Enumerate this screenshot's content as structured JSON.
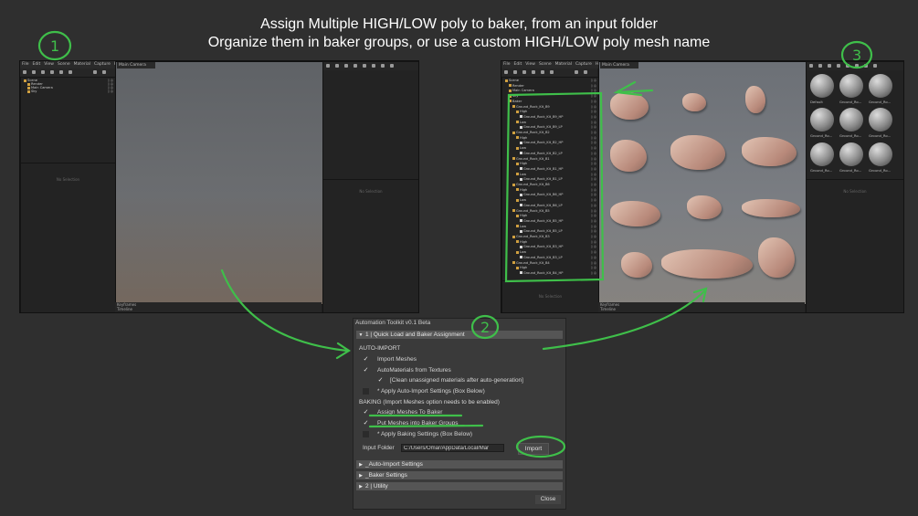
{
  "headline": {
    "line1": "Assign Multiple HIGH/LOW poly to baker, from an input folder",
    "line2": "Organize them in baker groups, or use a custom HIGH/LOW poly mesh name"
  },
  "annotations": {
    "step1": "1",
    "step2": "2",
    "step3": "3"
  },
  "app": {
    "menu": [
      "File",
      "Edit",
      "View",
      "Scene",
      "Material",
      "Capture",
      "Help"
    ],
    "viewport_tab": "Main Camera",
    "no_selection": "No Selection",
    "keyframes": "Keyframes",
    "timeline": "Timeline"
  },
  "left_scene_tree": [
    "Scene",
    "Render",
    "Main Camera",
    "Sky"
  ],
  "right_scene_tree": [
    "Scene",
    "Render",
    "Main Camera",
    "Sky",
    "Baker",
    "Ground_Rock_Kit_B9",
    "High",
    "Ground_Rock_Kit_B9_HP",
    "Low",
    "Ground_Rock_Kit_B9_LP",
    "Ground_Rock_Kit_B2",
    "High",
    "Ground_Rock_Kit_B2_HP",
    "Low",
    "Ground_Rock_Kit_B2_LP",
    "Ground_Rock_Kit_B1",
    "High",
    "Ground_Rock_Kit_B1_HP",
    "Low",
    "Ground_Rock_Kit_B1_LP",
    "Ground_Rock_Kit_B6",
    "High",
    "Ground_Rock_Kit_B6_HP",
    "Low",
    "Ground_Rock_Kit_B6_LP",
    "Ground_Rock_Kit_B5",
    "High",
    "Ground_Rock_Kit_B5_HP",
    "Low",
    "Ground_Rock_Kit_B5_LP",
    "Ground_Rock_Kit_B3",
    "High",
    "Ground_Rock_Kit_B3_HP",
    "Low",
    "Ground_Rock_Kit_B3_LP",
    "Ground_Rock_Kit_B4",
    "High",
    "Ground_Rock_Kit_B4_HP"
  ],
  "materials": [
    "Default",
    "Ground_Ro...",
    "Ground_Ro...",
    "Ground_Ro...",
    "Ground_Ro...",
    "Ground_Ro...",
    "Ground_Ro...",
    "Ground_Ro...",
    "Ground_Ro..."
  ],
  "dialog": {
    "title": "Automation Toolkit v0.1 Beta",
    "section1": "1 | Quick Load and Baker Assignment",
    "auto_import_header": "AUTO-IMPORT",
    "import_meshes": "Import Meshes",
    "automaterials": "AutoMaterials from Textures",
    "clean_unassigned": "[Clean unassigned materials after auto-generation]",
    "apply_auto_import": "* Apply Auto-Import Settings (Box Below)",
    "baking_header": "BAKING (Import Meshes option needs to be enabled)",
    "assign_meshes": "Assign Meshes To Baker",
    "put_meshes": "Put Meshes into Baker Groups",
    "apply_baking": "* Apply Baking Settings (Box Below)",
    "input_folder_label": "Input Folder",
    "input_folder_value": "C:/Users/Omar/AppData/Local/Mar",
    "import_button": "Import",
    "section_auto_import": "_Auto-Import Settings",
    "section_baker": "_Baker Settings",
    "section_utility": "2 | Utility",
    "close_button": "Close"
  },
  "colors": {
    "annotation_green": "#3fbf4a",
    "background": "#2f2f2f",
    "section_bar": "#555555"
  }
}
